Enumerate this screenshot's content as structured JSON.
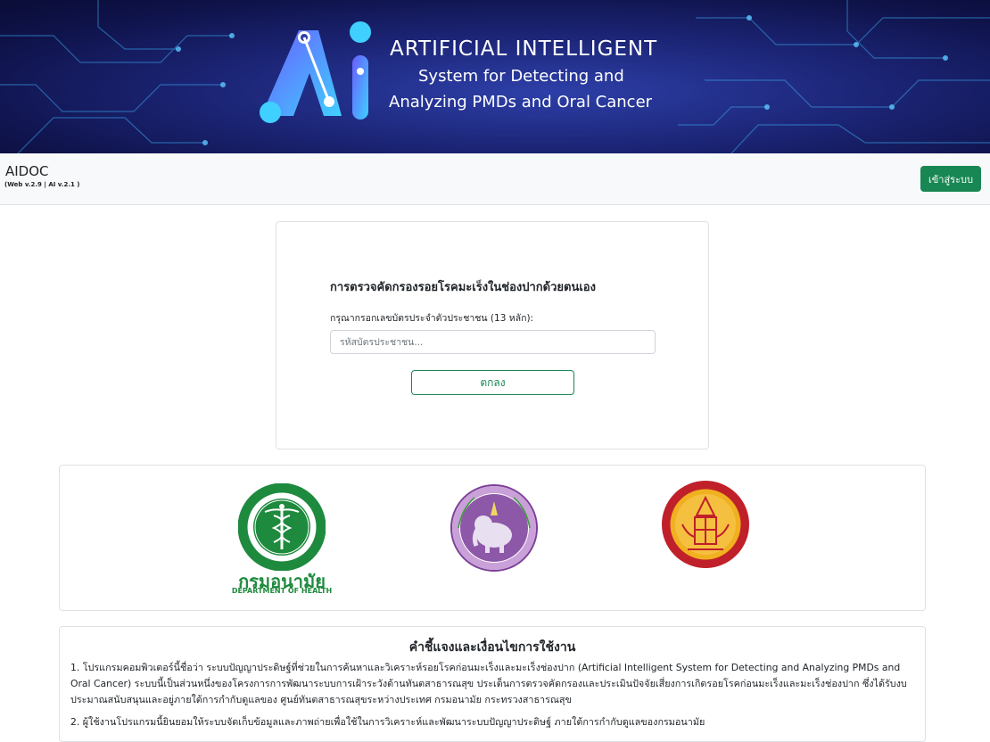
{
  "banner": {
    "title": "ARTIFICIAL INTELLIGENT",
    "subtitle1": "System for Detecting and",
    "subtitle2": "Analyzing PMDs and Oral Cancer",
    "logo_icon": "ai-logo-icon"
  },
  "navbar": {
    "brand": "AIDOC",
    "version": "(Web v.2.9 | AI v.2.1 )",
    "login_label": "เข้าสู่ระบบ"
  },
  "screening": {
    "title": "การตรวจคัดกรองรอยโรคมะเร็งในช่องปากด้วยตนเอง",
    "id_label": "กรุณากรอกเลขบัตรประจำตัวประชาชน (13 หลัก):",
    "id_placeholder": "รหัสบัตรประชาชน...",
    "id_value": "",
    "submit_label": "ตกลง"
  },
  "logos": {
    "moph_seal": "ministry-of-public-health-seal",
    "dept_name_th": "กรมอนามัย",
    "dept_name_en": "DEPARTMENT OF HEALTH",
    "cmu_seal": "chiang-mai-university-seal",
    "tu_seal": "thammasat-university-seal"
  },
  "terms": {
    "title": "คำชี้แจงและเงื่อนไขการใช้งาน",
    "item1": "1. โปรแกรมคอมพิวเตอร์นี้ชื่อว่า ระบบปัญญาประดิษฐ์ที่ช่วยในการค้นหาและวิเคราะห์รอยโรคก่อนมะเร็งและมะเร็งช่องปาก (Artificial Intelligent System for Detecting and Analyzing PMDs and Oral Cancer) ระบบนี้เป็นส่วนหนึ่งของโครงการการพัฒนาระบบการเฝ้าระวังด้านทันตสาธารณสุข ประเด็นการตรวจคัดกรองและประเมินปัจจัยเสี่ยงการเกิดรอยโรคก่อนมะเร็งและมะเร็งช่องปาก ซึ่งได้รับงบประมาณสนับสนุนและอยู่ภายใต้การกำกับดูแลของ ศูนย์ทันตสาธารณสุขระหว่างประเทศ กรมอนามัย กระทรวงสาธารณสุข",
    "item2": "2. ผู้ใช้งานโปรแกรมนี้ยินยอมให้ระบบจัดเก็บข้อมูลและภาพถ่ายเพื่อใช้ในการวิเคราะห์และพัฒนาระบบปัญญาประดิษฐ์ ภายใต้การกำกับดูแลของกรมอนามัย"
  },
  "colors": {
    "brand_green": "#198754",
    "banner_dark": "#0e1248",
    "dept_green": "#1e8a3e"
  }
}
